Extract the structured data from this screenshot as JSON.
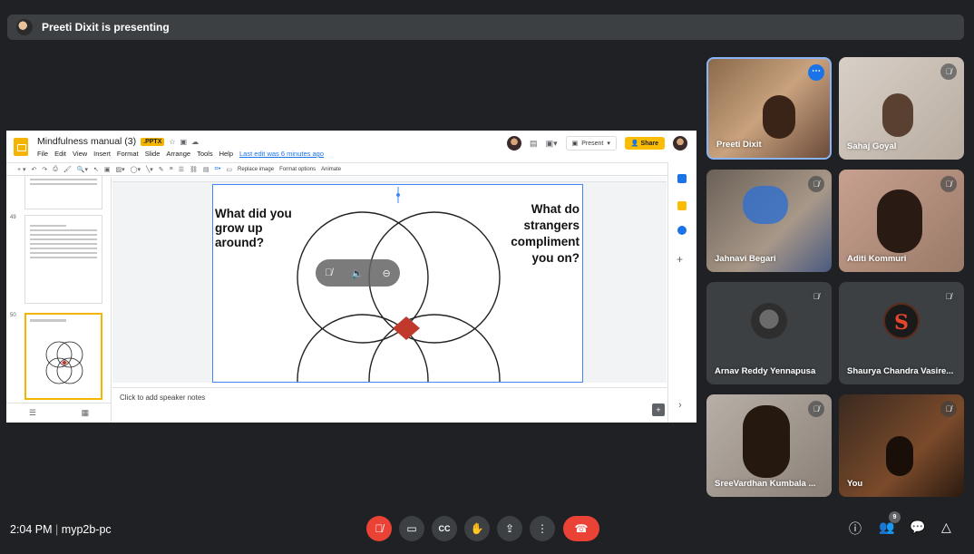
{
  "presenting_banner": "Preeti Dixit is presenting",
  "slides_app": {
    "doc_title": "Mindfulness manual (3)",
    "file_badge": ".PPTX",
    "menu": [
      "File",
      "Edit",
      "View",
      "Insert",
      "Format",
      "Slide",
      "Arrange",
      "Tools",
      "Help"
    ],
    "last_edit": "Last edit was 6 minutes ago",
    "present_label": "Present",
    "share_label": "Share",
    "toolbar_replace_image": "Replace image",
    "toolbar_format_options": "Format options",
    "toolbar_animate": "Animate",
    "thumb_numbers": [
      "49",
      "50"
    ],
    "slide_left_text": "What did you\ngrow up\naround?",
    "slide_right_text": "What do\nstrangers\ncompliment\nyou on?",
    "speaker_notes_placeholder": "Click to add speaker notes"
  },
  "participants": [
    {
      "name": "Preeti Dixit",
      "muted": false,
      "active": true
    },
    {
      "name": "Sahaj Goyal",
      "muted": true
    },
    {
      "name": "Jahnavi Begari",
      "muted": true
    },
    {
      "name": "Aditi Kommuri",
      "muted": true
    },
    {
      "name": "Arnav Reddy Yennapusa",
      "muted": true
    },
    {
      "name": "Shaurya Chandra Vasire...",
      "muted": true,
      "initial": "S"
    },
    {
      "name": "SreeVardhan Kumbala ...",
      "muted": true
    },
    {
      "name": "You",
      "muted": true
    }
  ],
  "bottom_bar": {
    "time": "2:04 PM",
    "meeting_code": "myp2b-pc",
    "people_count": "9"
  },
  "icons": {
    "mic_off": "mic-off-icon",
    "camera": "camera-icon",
    "captions": "captions-icon",
    "hand": "raise-hand-icon",
    "present": "present-icon",
    "more": "more-vert-icon",
    "end_call": "end-call-icon",
    "info": "info-icon",
    "people": "people-icon",
    "chat": "chat-icon",
    "activities": "activities-icon"
  },
  "colors": {
    "background": "#202124",
    "tile": "#3c4043",
    "end_call": "#ea4335",
    "accent": "#1a73e8",
    "slides_yellow": "#f4b400",
    "venn_overlap": "#c0392b"
  }
}
